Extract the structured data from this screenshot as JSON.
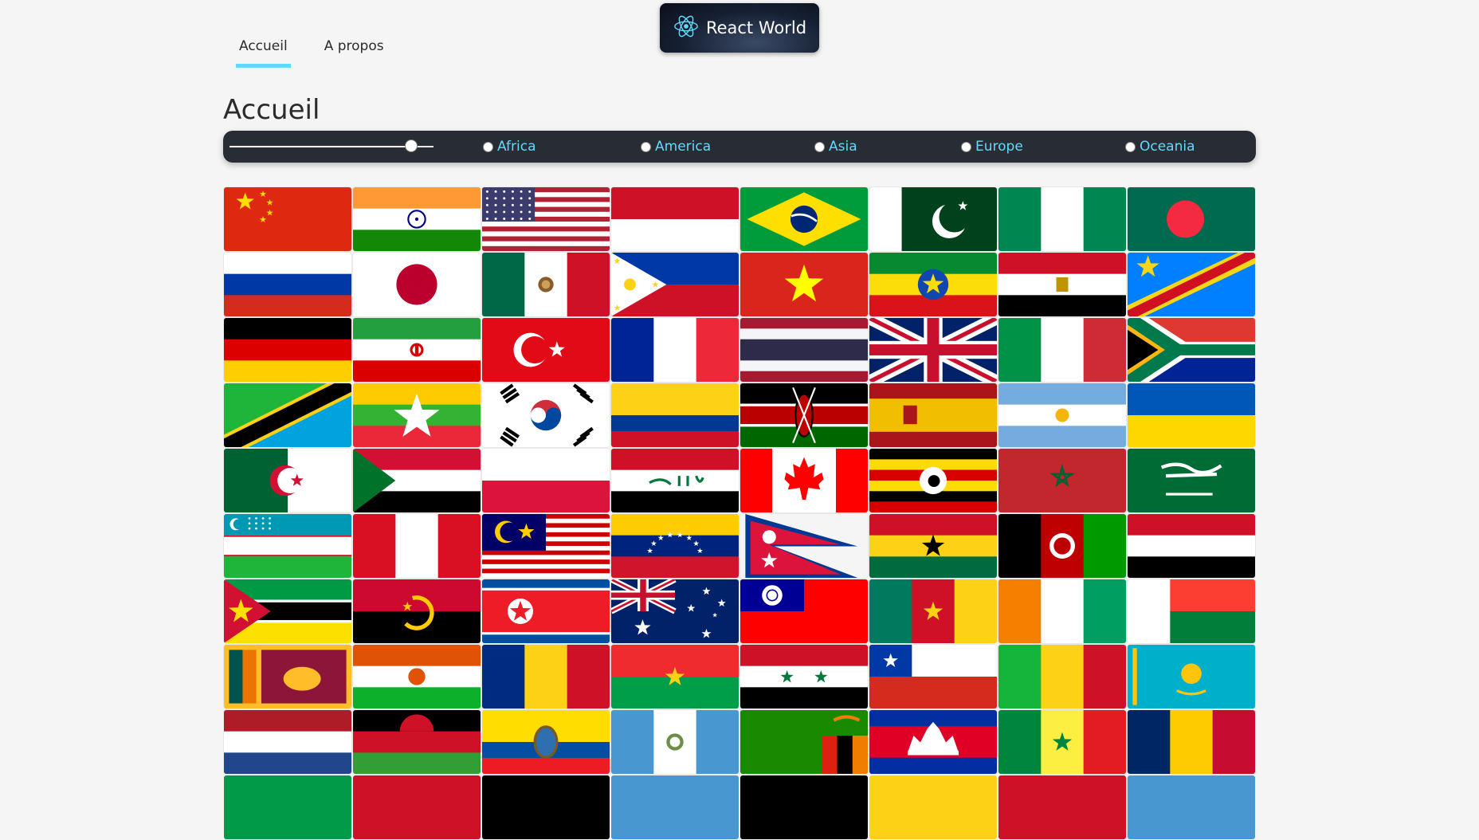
{
  "nav": {
    "items": [
      {
        "label": "Accueil",
        "active": true
      },
      {
        "label": "A propos",
        "active": false
      }
    ]
  },
  "logo": {
    "title": "React World",
    "icon": "react-atom-icon",
    "accent": "#61dafb"
  },
  "page": {
    "title": "Accueil"
  },
  "filter": {
    "slider_value_fraction": 0.89,
    "regions": [
      "Africa",
      "America",
      "Asia",
      "Europe",
      "Oceania"
    ]
  },
  "flags": [
    "china",
    "india",
    "usa",
    "indonesia",
    "brazil",
    "pakistan",
    "nigeria",
    "bangladesh",
    "russia",
    "japan",
    "mexico",
    "philippines",
    "vietnam",
    "ethiopia",
    "egypt",
    "dr-congo",
    "germany",
    "iran",
    "turkey",
    "france",
    "thailand",
    "united-kingdom",
    "italy",
    "south-africa",
    "tanzania",
    "myanmar",
    "south-korea",
    "colombia",
    "kenya",
    "spain",
    "argentina",
    "ukraine",
    "algeria",
    "sudan",
    "poland",
    "iraq",
    "canada",
    "uganda",
    "morocco",
    "saudi-arabia",
    "uzbekistan",
    "peru",
    "malaysia",
    "venezuela",
    "nepal",
    "ghana",
    "afghanistan",
    "yemen",
    "mozambique",
    "angola",
    "north-korea",
    "australia",
    "taiwan",
    "cameroon",
    "ivory-coast",
    "madagascar",
    "sri-lanka",
    "niger",
    "romania",
    "burkina-faso",
    "syria",
    "chile",
    "mali",
    "kazakhstan",
    "netherlands",
    "malawi",
    "ecuador",
    "guatemala",
    "zambia",
    "cambodia",
    "senegal",
    "chad"
  ],
  "partial_row_colors": [
    "#009a49",
    "#ce1126",
    "#000000",
    "#4997d0",
    "#000000",
    "#fcd116",
    "#ce1126",
    "#4997d0"
  ]
}
